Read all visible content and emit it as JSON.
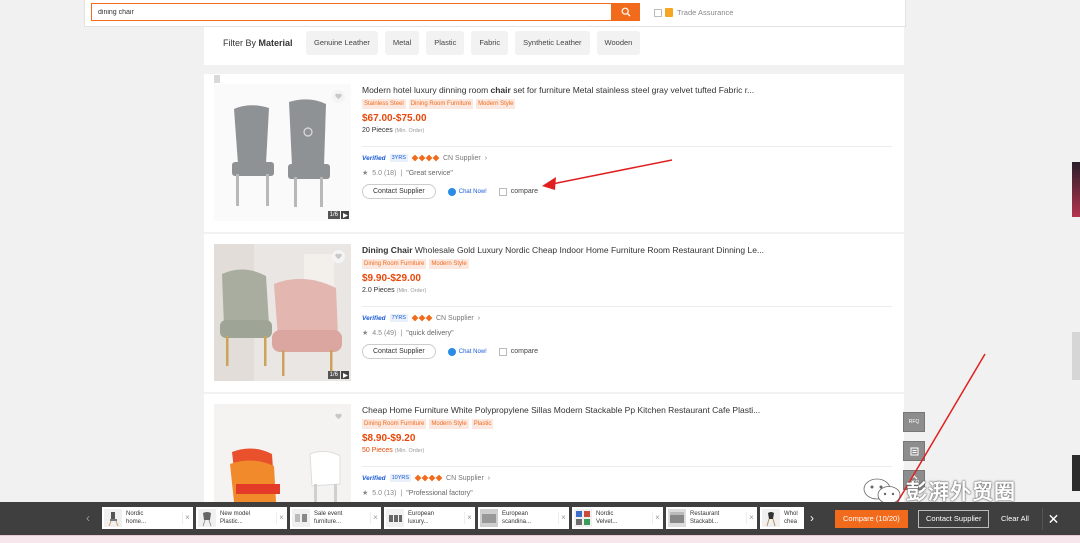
{
  "search": {
    "value": "dining chair",
    "trade_assurance_label": "Trade Assurance"
  },
  "filter": {
    "label": "Filter By",
    "label_bold": "Material",
    "chips": [
      "Genuine Leather",
      "Metal",
      "Plastic",
      "Fabric",
      "Synthetic Leather",
      "Wooden"
    ]
  },
  "products": [
    {
      "title_before": "Modern hotel luxury dinning room ",
      "title_bold": "chair",
      "title_after": " set for furniture Metal stainless steel gray velvet tufted Fabric r...",
      "tags": [
        "Stainless Steel",
        "Dining Room Furniture",
        "Modern Style"
      ],
      "price": "$67.00-$75.00",
      "moq": "20 Pieces",
      "moq_note": "(Min. Order)",
      "verified": "Verified",
      "years": "3YRS",
      "supplier": "CN Supplier",
      "rating": "5.0 (18)",
      "review": "\"Great service\"",
      "pager": "1/6"
    },
    {
      "title_before": "",
      "title_bold": "Dining Chair",
      "title_after": " Wholesale Gold Luxury Nordic Cheap Indoor Home Furniture Room Restaurant Dinning Le...",
      "tags": [
        "Dining Room Furniture",
        "Modern Style"
      ],
      "price": "$9.90-$29.00",
      "moq": "2.0 Pieces",
      "moq_note": "(Min. Order)",
      "verified": "Verified",
      "years": "7YRS",
      "supplier": "CN Supplier",
      "rating": "4.5 (49)",
      "review": "\"quick delivery\"",
      "pager": "1/6"
    },
    {
      "title_before": "",
      "title_bold": "",
      "title_after": "Cheap Home Furniture White Polypropylene Sillas Modern Stackable Pp Kitchen Restaurant Cafe Plasti...",
      "tags": [
        "Dining Room Furniture",
        "Modern Style",
        "Plastic"
      ],
      "price": "$8.90-$9.20",
      "moq": "50 Pieces",
      "moq_note": "(Min. Order)",
      "verified": "Verified",
      "years": "10YRS",
      "supplier": "CN Supplier",
      "rating": "5.0 (13)",
      "review": "\"Professional factory\""
    }
  ],
  "actions": {
    "contact": "Contact Supplier",
    "chat": "Chat Now!",
    "compare": "compare"
  },
  "side_tools": {
    "rfq": "RFQ",
    "top": "TOP"
  },
  "compare_bar": {
    "items": [
      {
        "l1": "Nordic",
        "l2": "home..."
      },
      {
        "l1": "New model",
        "l2": "Plastic..."
      },
      {
        "l1": "Sale event",
        "l2": "furniture..."
      },
      {
        "l1": "European",
        "l2": "luxury..."
      },
      {
        "l1": "European",
        "l2": "scandina..."
      },
      {
        "l1": "Nordic",
        "l2": "Velvet..."
      },
      {
        "l1": "Restaurant",
        "l2": "Stackabl..."
      },
      {
        "l1": "Whol",
        "l2": "chea"
      }
    ],
    "compare_label": "Compare (10/20)",
    "contact_label": "Contact Supplier",
    "clear_label": "Clear All"
  },
  "watermark": "彭湃外贸圈",
  "colors": {
    "accent": "#f26b1d",
    "price": "#e8480b",
    "verified": "#1a5bd6",
    "annotation_arrow": "#e02020",
    "compare_bar_bg": "#3f3f3f"
  }
}
